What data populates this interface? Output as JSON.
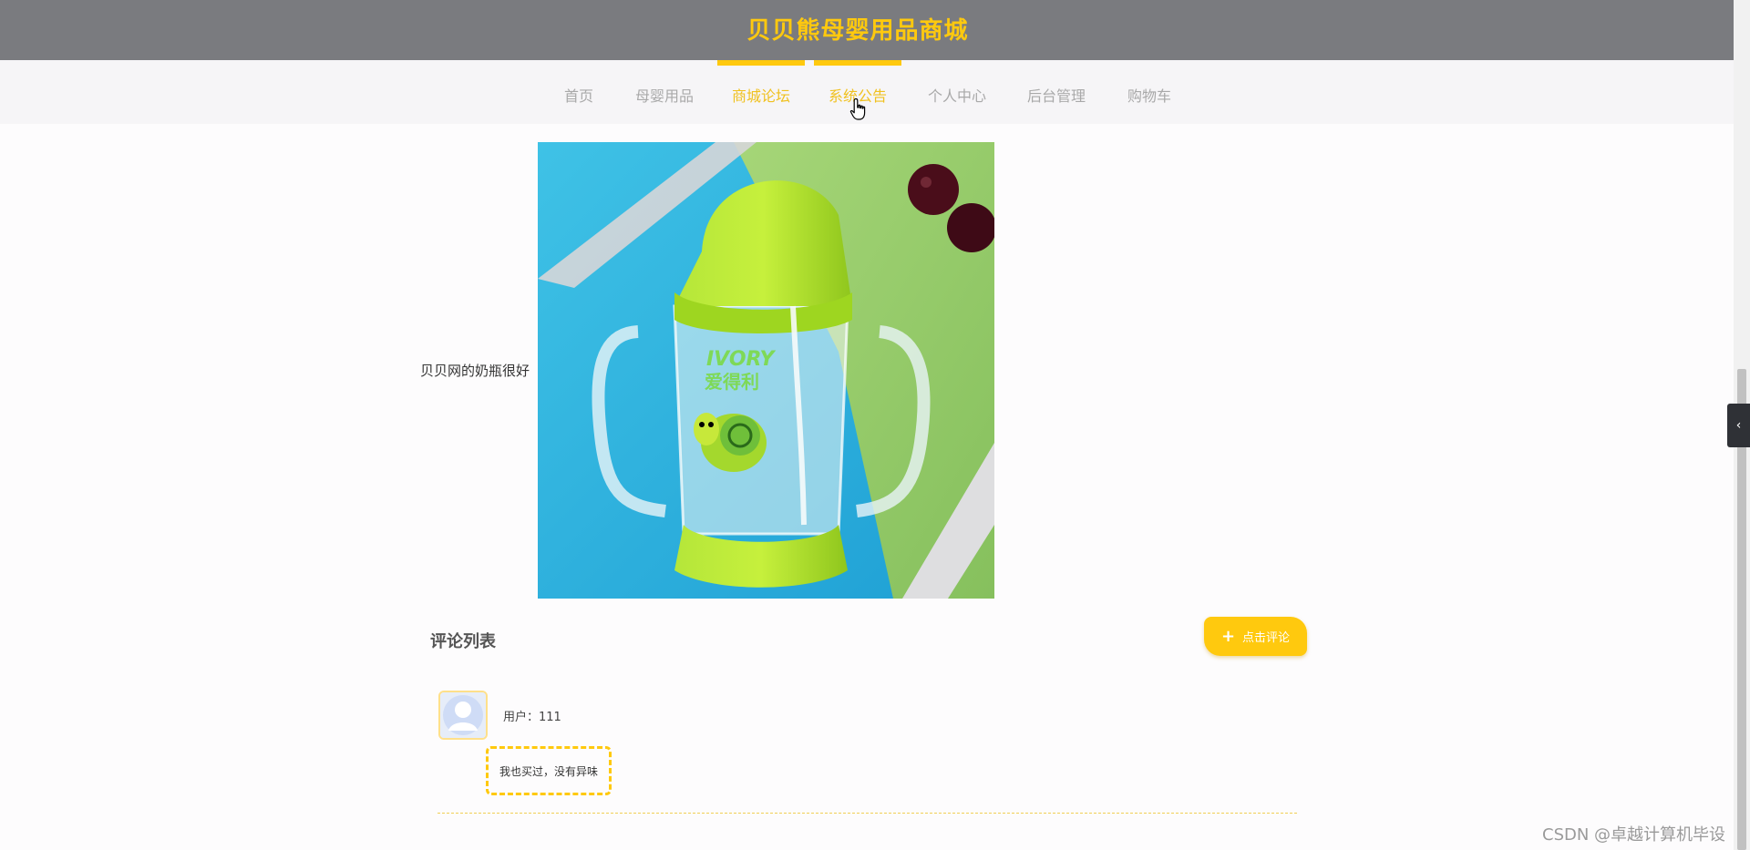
{
  "header": {
    "title": "贝贝熊母婴用品商城"
  },
  "nav": {
    "items": [
      {
        "label": "首页"
      },
      {
        "label": "母婴用品"
      },
      {
        "label": "商城论坛"
      },
      {
        "label": "系统公告"
      },
      {
        "label": "个人中心"
      },
      {
        "label": "后台管理"
      },
      {
        "label": "购物车"
      }
    ]
  },
  "post": {
    "text": "贝贝网的奶瓶很好",
    "image_icon": "baby-sippy-cup-photo"
  },
  "comments": {
    "title": "评论列表",
    "add_button_label": "点击评论",
    "list": [
      {
        "user": "用户：111",
        "content": "我也买过，没有异味"
      }
    ]
  },
  "side_toggle_label": "‹",
  "watermark": "CSDN @卓越计算机毕设",
  "colors": {
    "accent": "#ffc90e",
    "header_bg": "#7a7b7f",
    "nav_bg": "#f6f5f7"
  }
}
